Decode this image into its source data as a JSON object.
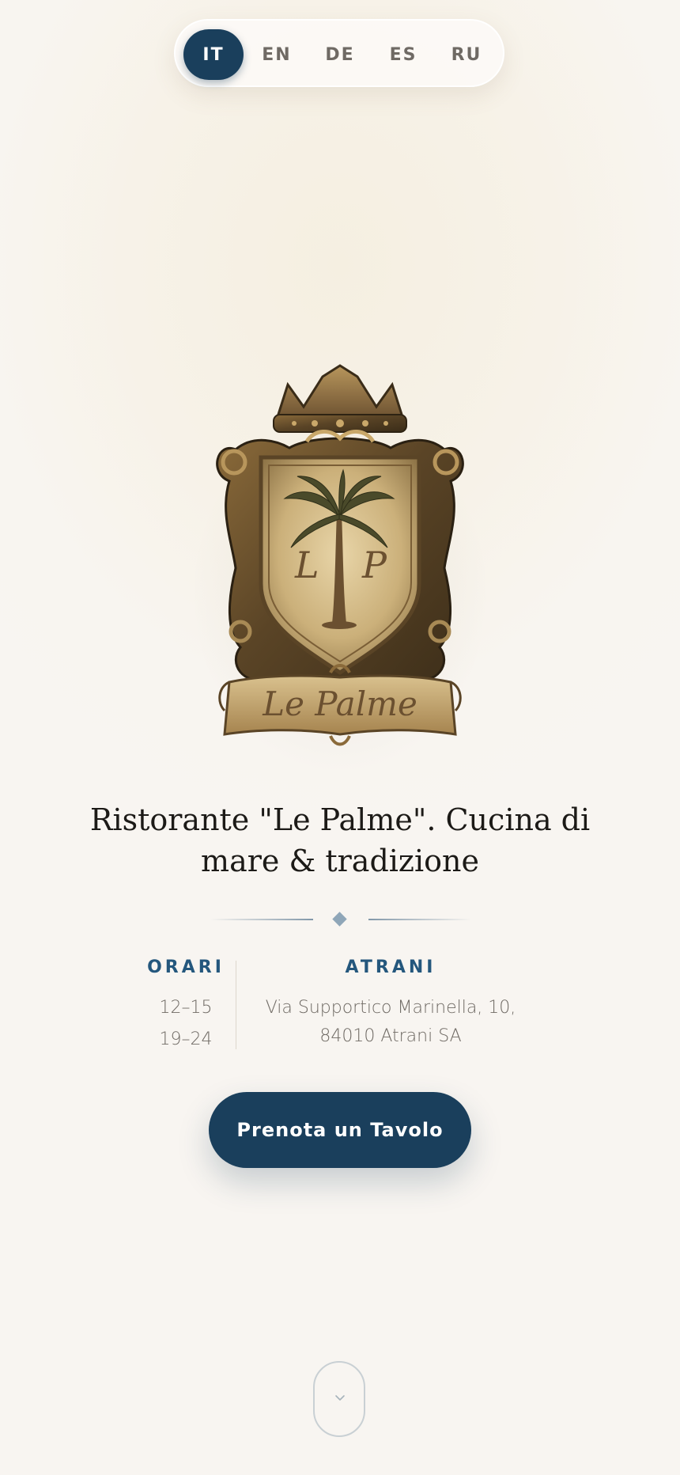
{
  "languages": {
    "items": [
      {
        "code": "IT",
        "active": true
      },
      {
        "code": "EN",
        "active": false
      },
      {
        "code": "DE",
        "active": false
      },
      {
        "code": "ES",
        "active": false
      },
      {
        "code": "RU",
        "active": false
      }
    ]
  },
  "crest": {
    "initials": "L P",
    "banner_text": "Le Palme",
    "icon": "palm-tree-crest-logo"
  },
  "hero": {
    "title": "Ristorante \"Le Palme\". Cucina di mare & tradizione"
  },
  "hours": {
    "label": "ORARI",
    "lunch": "12–15",
    "dinner": "19–24"
  },
  "location": {
    "label": "ATRANI",
    "address_line1": "Via Supportico Marinella, 10,",
    "address_line2": "84010 Atrani SA"
  },
  "cta": {
    "label": "Prenota un Tavolo"
  },
  "scroll": {
    "icon": "chevron-down-icon"
  },
  "colors": {
    "primary": "#1a3f5c",
    "accent": "#24577d",
    "text": "#1c1a17",
    "muted": "#6f6a64",
    "gold": "#a88a55"
  }
}
